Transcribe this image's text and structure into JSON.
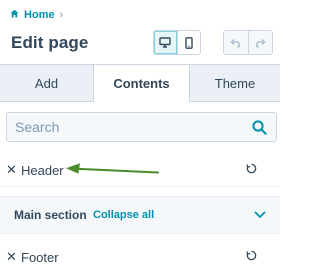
{
  "breadcrumb": {
    "home_label": "Home",
    "separator": "›"
  },
  "page_title": "Edit page",
  "tabs": [
    {
      "label": "Add",
      "active": false
    },
    {
      "label": "Contents",
      "active": true
    },
    {
      "label": "Theme",
      "active": false
    }
  ],
  "search": {
    "placeholder": "Search",
    "value": ""
  },
  "rows": {
    "header": {
      "label": "Header"
    },
    "main_section": {
      "title": "Main section",
      "collapse_label": "Collapse all"
    },
    "footer": {
      "label": "Footer"
    }
  },
  "icons": {
    "home": "home-icon",
    "desktop": "desktop-icon",
    "mobile": "mobile-icon",
    "undo": "undo-icon",
    "redo": "redo-icon",
    "search": "search-icon",
    "remove": "close-icon",
    "refresh": "refresh-icon",
    "chevron": "chevron-down-icon"
  },
  "colors": {
    "accent": "#0091ae",
    "text": "#33475b",
    "arrow": "#4a8a2a"
  }
}
